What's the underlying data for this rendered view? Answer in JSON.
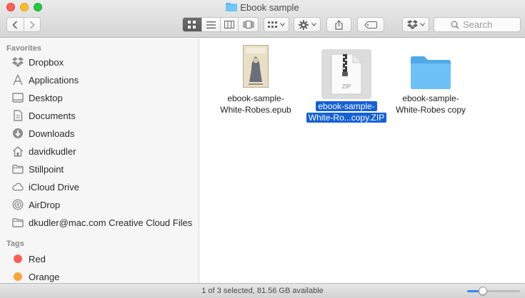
{
  "window": {
    "title": "Ebook sample"
  },
  "toolbar": {
    "search_placeholder": "Search",
    "icons": [
      "back-icon",
      "forward-icon",
      "icon-view-icon",
      "list-view-icon",
      "column-view-icon",
      "coverflow-view-icon",
      "arrange-icon",
      "action-gear-icon",
      "share-icon",
      "tag-icon",
      "dropbox-icon",
      "search-icon"
    ]
  },
  "sidebar": {
    "favorites_heading": "Favorites",
    "favorites": [
      {
        "label": "Dropbox",
        "icon": "dropbox-icon"
      },
      {
        "label": "Applications",
        "icon": "applications-icon"
      },
      {
        "label": "Desktop",
        "icon": "desktop-icon"
      },
      {
        "label": "Documents",
        "icon": "documents-icon"
      },
      {
        "label": "Downloads",
        "icon": "downloads-icon"
      },
      {
        "label": "davidkudler",
        "icon": "home-icon"
      },
      {
        "label": "Stillpoint",
        "icon": "folder-icon"
      },
      {
        "label": "iCloud Drive",
        "icon": "cloud-icon"
      },
      {
        "label": "AirDrop",
        "icon": "airdrop-icon"
      },
      {
        "label": "dkudler@mac.com Creative Cloud Files",
        "icon": "folder-icon"
      }
    ],
    "tags_heading": "Tags",
    "tags": [
      {
        "label": "Red",
        "color": "#fc5f57"
      },
      {
        "label": "Orange",
        "color": "#f8a33c"
      }
    ]
  },
  "files": [
    {
      "line1": "ebook-sample-",
      "line2": "White-Robes.epub",
      "selected": false,
      "kind": "epub",
      "cover_text": "White Robes"
    },
    {
      "line1": "ebook-sample-",
      "line2": "White-Ro...copy.ZIP",
      "selected": true,
      "kind": "zip",
      "badge": "ZIP"
    },
    {
      "line1": "ebook-sample-",
      "line2": "White-Robes copy",
      "selected": false,
      "kind": "folder"
    }
  ],
  "status": {
    "text": "1 of 3 selected, 81.56 GB available",
    "zoom_level": 0.25
  },
  "colors": {
    "selection": "#1560d4",
    "folder": "#5cb8f2"
  }
}
